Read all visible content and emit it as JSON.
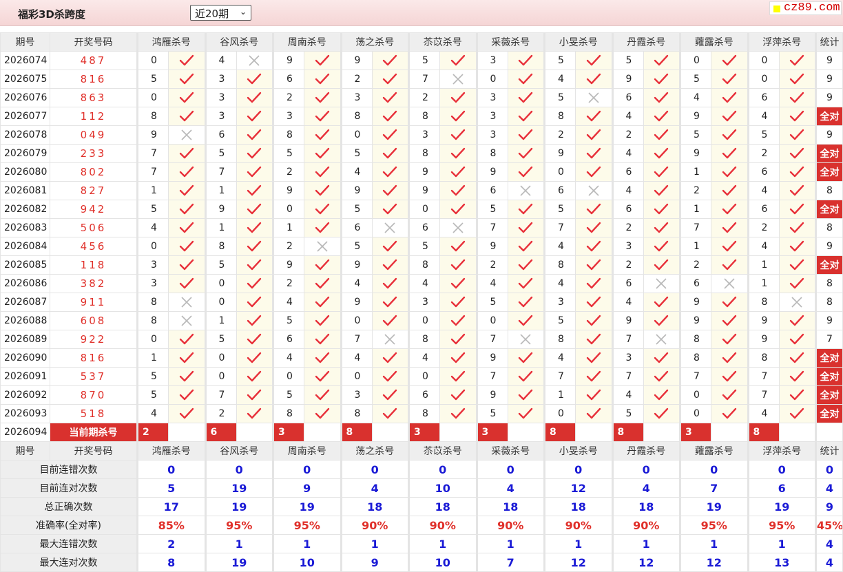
{
  "header": {
    "title": "福彩3D杀跨度",
    "period_select": "近20期",
    "logo": "cz89.com"
  },
  "columns": {
    "period": "期号",
    "draw": "开奖号码",
    "experts": [
      "鸿雁杀号",
      "谷风杀号",
      "周南杀号",
      "荡之杀号",
      "苶苡杀号",
      "采薇杀号",
      "小旻杀号",
      "丹霞杀号",
      "蕹露杀号",
      "浮萍杀号"
    ],
    "stat": "统计"
  },
  "rows": [
    {
      "period": "2026074",
      "draw": "487",
      "kills": [
        [
          "0",
          1
        ],
        [
          "4",
          0
        ],
        [
          "9",
          1
        ],
        [
          "9",
          1
        ],
        [
          "5",
          1
        ],
        [
          "3",
          1
        ],
        [
          "5",
          1
        ],
        [
          "5",
          1
        ],
        [
          "0",
          1
        ],
        [
          "0",
          1
        ]
      ],
      "stat": "9"
    },
    {
      "period": "2026075",
      "draw": "816",
      "kills": [
        [
          "5",
          1
        ],
        [
          "3",
          1
        ],
        [
          "6",
          1
        ],
        [
          "2",
          1
        ],
        [
          "7",
          0
        ],
        [
          "0",
          1
        ],
        [
          "4",
          1
        ],
        [
          "9",
          1
        ],
        [
          "5",
          1
        ],
        [
          "0",
          1
        ]
      ],
      "stat": "9"
    },
    {
      "period": "2026076",
      "draw": "863",
      "kills": [
        [
          "0",
          1
        ],
        [
          "3",
          1
        ],
        [
          "2",
          1
        ],
        [
          "3",
          1
        ],
        [
          "2",
          1
        ],
        [
          "3",
          1
        ],
        [
          "5",
          0
        ],
        [
          "6",
          1
        ],
        [
          "4",
          1
        ],
        [
          "6",
          1
        ]
      ],
      "stat": "9"
    },
    {
      "period": "2026077",
      "draw": "112",
      "kills": [
        [
          "8",
          1
        ],
        [
          "3",
          1
        ],
        [
          "3",
          1
        ],
        [
          "8",
          1
        ],
        [
          "8",
          1
        ],
        [
          "3",
          1
        ],
        [
          "8",
          1
        ],
        [
          "4",
          1
        ],
        [
          "9",
          1
        ],
        [
          "4",
          1
        ]
      ],
      "stat": "全对"
    },
    {
      "period": "2026078",
      "draw": "049",
      "kills": [
        [
          "9",
          0
        ],
        [
          "6",
          1
        ],
        [
          "8",
          1
        ],
        [
          "0",
          1
        ],
        [
          "3",
          1
        ],
        [
          "3",
          1
        ],
        [
          "2",
          1
        ],
        [
          "2",
          1
        ],
        [
          "5",
          1
        ],
        [
          "5",
          1
        ]
      ],
      "stat": "9"
    },
    {
      "period": "2026079",
      "draw": "233",
      "kills": [
        [
          "7",
          1
        ],
        [
          "5",
          1
        ],
        [
          "5",
          1
        ],
        [
          "5",
          1
        ],
        [
          "8",
          1
        ],
        [
          "8",
          1
        ],
        [
          "9",
          1
        ],
        [
          "4",
          1
        ],
        [
          "9",
          1
        ],
        [
          "2",
          1
        ]
      ],
      "stat": "全对"
    },
    {
      "period": "2026080",
      "draw": "802",
      "kills": [
        [
          "7",
          1
        ],
        [
          "7",
          1
        ],
        [
          "2",
          1
        ],
        [
          "4",
          1
        ],
        [
          "9",
          1
        ],
        [
          "9",
          1
        ],
        [
          "0",
          1
        ],
        [
          "6",
          1
        ],
        [
          "1",
          1
        ],
        [
          "6",
          1
        ]
      ],
      "stat": "全对"
    },
    {
      "period": "2026081",
      "draw": "827",
      "kills": [
        [
          "1",
          1
        ],
        [
          "1",
          1
        ],
        [
          "9",
          1
        ],
        [
          "9",
          1
        ],
        [
          "9",
          1
        ],
        [
          "6",
          0
        ],
        [
          "6",
          0
        ],
        [
          "4",
          1
        ],
        [
          "2",
          1
        ],
        [
          "4",
          1
        ]
      ],
      "stat": "8"
    },
    {
      "period": "2026082",
      "draw": "942",
      "kills": [
        [
          "5",
          1
        ],
        [
          "9",
          1
        ],
        [
          "0",
          1
        ],
        [
          "5",
          1
        ],
        [
          "0",
          1
        ],
        [
          "5",
          1
        ],
        [
          "5",
          1
        ],
        [
          "6",
          1
        ],
        [
          "1",
          1
        ],
        [
          "6",
          1
        ]
      ],
      "stat": "全对"
    },
    {
      "period": "2026083",
      "draw": "506",
      "kills": [
        [
          "4",
          1
        ],
        [
          "1",
          1
        ],
        [
          "1",
          1
        ],
        [
          "6",
          0
        ],
        [
          "6",
          0
        ],
        [
          "7",
          1
        ],
        [
          "7",
          1
        ],
        [
          "2",
          1
        ],
        [
          "7",
          1
        ],
        [
          "2",
          1
        ]
      ],
      "stat": "8"
    },
    {
      "period": "2026084",
      "draw": "456",
      "kills": [
        [
          "0",
          1
        ],
        [
          "8",
          1
        ],
        [
          "2",
          0
        ],
        [
          "5",
          1
        ],
        [
          "5",
          1
        ],
        [
          "9",
          1
        ],
        [
          "4",
          1
        ],
        [
          "3",
          1
        ],
        [
          "1",
          1
        ],
        [
          "4",
          1
        ]
      ],
      "stat": "9"
    },
    {
      "period": "2026085",
      "draw": "118",
      "kills": [
        [
          "3",
          1
        ],
        [
          "5",
          1
        ],
        [
          "9",
          1
        ],
        [
          "9",
          1
        ],
        [
          "8",
          1
        ],
        [
          "2",
          1
        ],
        [
          "8",
          1
        ],
        [
          "2",
          1
        ],
        [
          "2",
          1
        ],
        [
          "1",
          1
        ]
      ],
      "stat": "全对"
    },
    {
      "period": "2026086",
      "draw": "382",
      "kills": [
        [
          "3",
          1
        ],
        [
          "0",
          1
        ],
        [
          "2",
          1
        ],
        [
          "4",
          1
        ],
        [
          "4",
          1
        ],
        [
          "4",
          1
        ],
        [
          "4",
          1
        ],
        [
          "6",
          0
        ],
        [
          "6",
          0
        ],
        [
          "1",
          1
        ]
      ],
      "stat": "8"
    },
    {
      "period": "2026087",
      "draw": "911",
      "kills": [
        [
          "8",
          0
        ],
        [
          "0",
          1
        ],
        [
          "4",
          1
        ],
        [
          "9",
          1
        ],
        [
          "3",
          1
        ],
        [
          "5",
          1
        ],
        [
          "3",
          1
        ],
        [
          "4",
          1
        ],
        [
          "9",
          1
        ],
        [
          "8",
          0
        ]
      ],
      "stat": "8"
    },
    {
      "period": "2026088",
      "draw": "608",
      "kills": [
        [
          "8",
          0
        ],
        [
          "1",
          1
        ],
        [
          "5",
          1
        ],
        [
          "0",
          1
        ],
        [
          "0",
          1
        ],
        [
          "0",
          1
        ],
        [
          "5",
          1
        ],
        [
          "9",
          1
        ],
        [
          "9",
          1
        ],
        [
          "9",
          1
        ]
      ],
      "stat": "9"
    },
    {
      "period": "2026089",
      "draw": "922",
      "kills": [
        [
          "0",
          1
        ],
        [
          "5",
          1
        ],
        [
          "6",
          1
        ],
        [
          "7",
          0
        ],
        [
          "8",
          1
        ],
        [
          "7",
          0
        ],
        [
          "8",
          1
        ],
        [
          "7",
          0
        ],
        [
          "8",
          1
        ],
        [
          "9",
          1
        ]
      ],
      "stat": "7"
    },
    {
      "period": "2026090",
      "draw": "816",
      "kills": [
        [
          "1",
          1
        ],
        [
          "0",
          1
        ],
        [
          "4",
          1
        ],
        [
          "4",
          1
        ],
        [
          "4",
          1
        ],
        [
          "9",
          1
        ],
        [
          "4",
          1
        ],
        [
          "3",
          1
        ],
        [
          "8",
          1
        ],
        [
          "8",
          1
        ]
      ],
      "stat": "全对"
    },
    {
      "period": "2026091",
      "draw": "537",
      "kills": [
        [
          "5",
          1
        ],
        [
          "0",
          1
        ],
        [
          "0",
          1
        ],
        [
          "0",
          1
        ],
        [
          "0",
          1
        ],
        [
          "7",
          1
        ],
        [
          "7",
          1
        ],
        [
          "7",
          1
        ],
        [
          "7",
          1
        ],
        [
          "7",
          1
        ]
      ],
      "stat": "全对"
    },
    {
      "period": "2026092",
      "draw": "870",
      "kills": [
        [
          "5",
          1
        ],
        [
          "7",
          1
        ],
        [
          "5",
          1
        ],
        [
          "3",
          1
        ],
        [
          "6",
          1
        ],
        [
          "9",
          1
        ],
        [
          "1",
          1
        ],
        [
          "4",
          1
        ],
        [
          "0",
          1
        ],
        [
          "7",
          1
        ]
      ],
      "stat": "全对"
    },
    {
      "period": "2026093",
      "draw": "518",
      "kills": [
        [
          "4",
          1
        ],
        [
          "2",
          1
        ],
        [
          "8",
          1
        ],
        [
          "8",
          1
        ],
        [
          "8",
          1
        ],
        [
          "5",
          1
        ],
        [
          "0",
          1
        ],
        [
          "5",
          1
        ],
        [
          "0",
          1
        ],
        [
          "4",
          1
        ]
      ],
      "stat": "全对"
    }
  ],
  "current": {
    "period": "2026094",
    "label": "当前期杀号",
    "kills": [
      "2",
      "6",
      "3",
      "8",
      "3",
      "3",
      "8",
      "8",
      "3",
      "8"
    ]
  },
  "stats": [
    {
      "label": "目前连错次数",
      "values": [
        "0",
        "0",
        "0",
        "0",
        "0",
        "0",
        "0",
        "0",
        "0",
        "0"
      ],
      "stat": "0"
    },
    {
      "label": "目前连对次数",
      "values": [
        "5",
        "19",
        "9",
        "4",
        "10",
        "4",
        "12",
        "4",
        "7",
        "6"
      ],
      "stat": "4"
    },
    {
      "label": "总正确次数",
      "values": [
        "17",
        "19",
        "19",
        "18",
        "18",
        "18",
        "18",
        "18",
        "19",
        "19"
      ],
      "stat": "9"
    },
    {
      "label": "准确率(全对率)",
      "values": [
        "85%",
        "95%",
        "95%",
        "90%",
        "90%",
        "90%",
        "90%",
        "90%",
        "95%",
        "95%"
      ],
      "stat": "45%"
    },
    {
      "label": "最大连错次数",
      "values": [
        "2",
        "1",
        "1",
        "1",
        "1",
        "1",
        "1",
        "1",
        "1",
        "1"
      ],
      "stat": "4"
    },
    {
      "label": "最大连对次数",
      "values": [
        "8",
        "19",
        "10",
        "9",
        "10",
        "7",
        "12",
        "12",
        "12",
        "13"
      ],
      "stat": "4"
    }
  ],
  "colors": {
    "accent": "#d9312e",
    "check": "#e8303a",
    "blue": "#1a1ad6"
  }
}
